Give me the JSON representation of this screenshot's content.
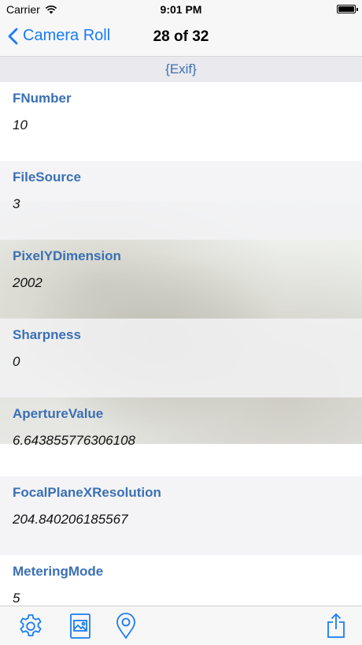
{
  "status_bar": {
    "carrier": "Carrier",
    "time": "9:01 PM"
  },
  "nav": {
    "back_label": "Camera Roll",
    "title": "28 of 32"
  },
  "section": {
    "title": "{Exif}"
  },
  "rows": [
    {
      "key": "FNumber",
      "value": "10"
    },
    {
      "key": "FileSource",
      "value": "3"
    },
    {
      "key": "PixelYDimension",
      "value": "2002"
    },
    {
      "key": "Sharpness",
      "value": "0"
    },
    {
      "key": "ApertureValue",
      "value": "6.643855776306108"
    },
    {
      "key": "FocalPlaneXResolution",
      "value": "204.840206185567"
    },
    {
      "key": "MeteringMode",
      "value": "5"
    }
  ],
  "toolbar": {
    "items": [
      "gear-icon",
      "photo-icon",
      "location-pin-icon",
      "share-icon"
    ]
  },
  "colors": {
    "accent": "#1a7cf5",
    "key_text": "#3a70b4",
    "section_bg": "#e9e9ee"
  }
}
